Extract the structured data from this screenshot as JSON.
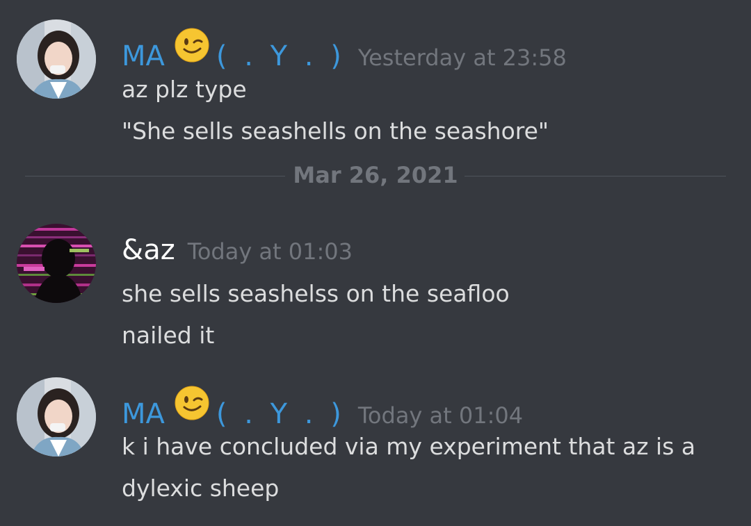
{
  "messages": [
    {
      "username": "MA",
      "name_emoji": "winking-face",
      "name_suffix": "( . Y . )",
      "timestamp": "Yesterday at 23:58",
      "lines": [
        "az plz type",
        "\"She sells seashells on the seashore\""
      ]
    },
    {
      "username": "&az",
      "timestamp": "Today at 01:03",
      "lines": [
        "she sells seashelss on the seafloo",
        "nailed it"
      ]
    },
    {
      "username": "MA",
      "name_emoji": "winking-face",
      "name_suffix": "( . Y . )",
      "timestamp": "Today at 01:04",
      "lines": [
        "k i have concluded via my experiment that az is a",
        "dylexic sheep"
      ]
    }
  ],
  "date_divider": "Mar 26, 2021",
  "colors": {
    "background": "#36393f",
    "username_blue": "#3d98dc",
    "timestamp_gray": "#72767d",
    "message_text": "#dcddde"
  }
}
